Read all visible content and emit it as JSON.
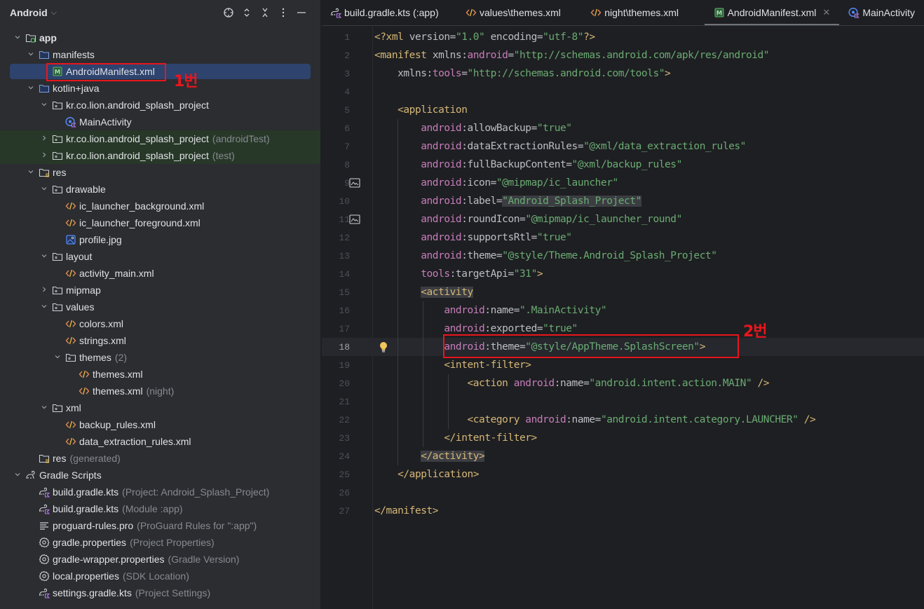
{
  "project_panel": {
    "title": "Android",
    "actions": [
      {
        "name": "locate-icon",
        "label": "Select Opened File"
      },
      {
        "name": "expand-all-icon",
        "label": "Expand All"
      },
      {
        "name": "collapse-all-icon",
        "label": "Collapse All"
      },
      {
        "name": "more-options-icon",
        "label": "Options"
      },
      {
        "name": "hide-panel-icon",
        "label": "Hide"
      }
    ],
    "tree": [
      {
        "label": "app",
        "hint": "",
        "level": 0,
        "arrow": "down",
        "icon": "module-folder",
        "bold": true
      },
      {
        "label": "manifests",
        "hint": "",
        "level": 1,
        "arrow": "down",
        "icon": "folder-blue"
      },
      {
        "label": "AndroidManifest.xml",
        "hint": "",
        "level": 2,
        "arrow": "",
        "icon": "manifest",
        "selected": true
      },
      {
        "label": "kotlin+java",
        "hint": "",
        "level": 1,
        "arrow": "down",
        "icon": "folder-blue"
      },
      {
        "label": "kr.co.lion.android_splash_project",
        "hint": "",
        "level": 2,
        "arrow": "down",
        "icon": "package"
      },
      {
        "label": "MainActivity",
        "hint": "",
        "level": 3,
        "arrow": "",
        "icon": "kotlin-class"
      },
      {
        "label": "kr.co.lion.android_splash_project",
        "hint": "(androidTest)",
        "level": 2,
        "arrow": "right",
        "icon": "package",
        "tested": true
      },
      {
        "label": "kr.co.lion.android_splash_project",
        "hint": "(test)",
        "level": 2,
        "arrow": "right",
        "icon": "package",
        "tested": true
      },
      {
        "label": "res",
        "hint": "",
        "level": 1,
        "arrow": "down",
        "icon": "res-folder"
      },
      {
        "label": "drawable",
        "hint": "",
        "level": 2,
        "arrow": "down",
        "icon": "package"
      },
      {
        "label": "ic_launcher_background.xml",
        "hint": "",
        "level": 3,
        "arrow": "",
        "icon": "xml"
      },
      {
        "label": "ic_launcher_foreground.xml",
        "hint": "",
        "level": 3,
        "arrow": "",
        "icon": "xml"
      },
      {
        "label": "profile.jpg",
        "hint": "",
        "level": 3,
        "arrow": "",
        "icon": "image"
      },
      {
        "label": "layout",
        "hint": "",
        "level": 2,
        "arrow": "down",
        "icon": "package"
      },
      {
        "label": "activity_main.xml",
        "hint": "",
        "level": 3,
        "arrow": "",
        "icon": "xml"
      },
      {
        "label": "mipmap",
        "hint": "",
        "level": 2,
        "arrow": "right",
        "icon": "package"
      },
      {
        "label": "values",
        "hint": "",
        "level": 2,
        "arrow": "down",
        "icon": "package"
      },
      {
        "label": "colors.xml",
        "hint": "",
        "level": 3,
        "arrow": "",
        "icon": "xml"
      },
      {
        "label": "strings.xml",
        "hint": "",
        "level": 3,
        "arrow": "",
        "icon": "xml"
      },
      {
        "label": "themes",
        "hint": "(2)",
        "level": 3,
        "arrow": "down",
        "icon": "package"
      },
      {
        "label": "themes.xml",
        "hint": "",
        "level": 4,
        "arrow": "",
        "icon": "xml"
      },
      {
        "label": "themes.xml",
        "hint": "(night)",
        "level": 4,
        "arrow": "",
        "icon": "xml"
      },
      {
        "label": "xml",
        "hint": "",
        "level": 2,
        "arrow": "down",
        "icon": "package"
      },
      {
        "label": "backup_rules.xml",
        "hint": "",
        "level": 3,
        "arrow": "",
        "icon": "xml"
      },
      {
        "label": "data_extraction_rules.xml",
        "hint": "",
        "level": 3,
        "arrow": "",
        "icon": "xml"
      },
      {
        "label": "res",
        "hint": "(generated)",
        "level": 1,
        "arrow": "",
        "icon": "res-folder"
      },
      {
        "label": "Gradle Scripts",
        "hint": "",
        "level": 0,
        "arrow": "down",
        "icon": "gradle"
      },
      {
        "label": "build.gradle.kts",
        "hint": "(Project: Android_Splash_Project)",
        "level": 1,
        "arrow": "",
        "icon": "gradle-kts"
      },
      {
        "label": "build.gradle.kts",
        "hint": "(Module :app)",
        "level": 1,
        "arrow": "",
        "icon": "gradle-kts"
      },
      {
        "label": "proguard-rules.pro",
        "hint": "(ProGuard Rules for \":app\")",
        "level": 1,
        "arrow": "",
        "icon": "text-lines"
      },
      {
        "label": "gradle.properties",
        "hint": "(Project Properties)",
        "level": 1,
        "arrow": "",
        "icon": "gear"
      },
      {
        "label": "gradle-wrapper.properties",
        "hint": "(Gradle Version)",
        "level": 1,
        "arrow": "",
        "icon": "gear"
      },
      {
        "label": "local.properties",
        "hint": "(SDK Location)",
        "level": 1,
        "arrow": "",
        "icon": "gear"
      },
      {
        "label": "settings.gradle.kts",
        "hint": "(Project Settings)",
        "level": 1,
        "arrow": "",
        "icon": "gradle-kts"
      }
    ]
  },
  "editor": {
    "tabs": [
      {
        "label": "build.gradle.kts (:app)",
        "icon": "gradle-kts",
        "active": false
      },
      {
        "label": "values\\themes.xml",
        "icon": "xml",
        "active": false
      },
      {
        "label": "night\\themes.xml",
        "icon": "xml",
        "active": false
      },
      {
        "label": "AndroidManifest.xml",
        "icon": "manifest",
        "active": true,
        "closable": true
      },
      {
        "label": "MainActivity",
        "icon": "kotlin-class",
        "active": false
      }
    ],
    "current_line": 18,
    "lines": [
      {
        "n": 1,
        "tokens": [
          [
            "tag",
            "<?xml "
          ],
          [
            "attr",
            "version"
          ],
          [
            "punct",
            "="
          ],
          [
            "val",
            "\"1.0\""
          ],
          [
            "attr",
            " encoding"
          ],
          [
            "punct",
            "="
          ],
          [
            "val",
            "\"utf-8\""
          ],
          [
            "tag",
            "?>"
          ]
        ]
      },
      {
        "n": 2,
        "tokens": [
          [
            "tag",
            "<manifest "
          ],
          [
            "attr",
            "xmlns:"
          ],
          [
            "ns",
            "android"
          ],
          [
            "punct",
            "="
          ],
          [
            "val",
            "\"http://schemas.android.com/apk/res/android\""
          ]
        ]
      },
      {
        "n": 3,
        "tokens": [
          [
            "punct",
            "    "
          ],
          [
            "attr",
            "xmlns:"
          ],
          [
            "ns",
            "tools"
          ],
          [
            "punct",
            "="
          ],
          [
            "val",
            "\"http://schemas.android.com/tools\""
          ],
          [
            "tag",
            ">"
          ]
        ]
      },
      {
        "n": 4,
        "tokens": []
      },
      {
        "n": 5,
        "tokens": [
          [
            "punct",
            "    "
          ],
          [
            "tag",
            "<application"
          ]
        ]
      },
      {
        "n": 6,
        "tokens": [
          [
            "punct",
            "        "
          ],
          [
            "ns",
            "android"
          ],
          [
            "attr",
            ":allowBackup"
          ],
          [
            "punct",
            "="
          ],
          [
            "val",
            "\"true\""
          ]
        ]
      },
      {
        "n": 7,
        "tokens": [
          [
            "punct",
            "        "
          ],
          [
            "ns",
            "android"
          ],
          [
            "attr",
            ":dataExtractionRules"
          ],
          [
            "punct",
            "="
          ],
          [
            "val",
            "\"@xml/data_extraction_rules\""
          ]
        ]
      },
      {
        "n": 8,
        "tokens": [
          [
            "punct",
            "        "
          ],
          [
            "ns",
            "android"
          ],
          [
            "attr",
            ":fullBackupContent"
          ],
          [
            "punct",
            "="
          ],
          [
            "val",
            "\"@xml/backup_rules\""
          ]
        ]
      },
      {
        "n": 9,
        "gutter": "image",
        "tokens": [
          [
            "punct",
            "        "
          ],
          [
            "ns",
            "android"
          ],
          [
            "attr",
            ":icon"
          ],
          [
            "punct",
            "="
          ],
          [
            "val",
            "\"@mipmap/ic_launcher\""
          ]
        ]
      },
      {
        "n": 10,
        "tokens": [
          [
            "punct",
            "        "
          ],
          [
            "ns",
            "android"
          ],
          [
            "attr",
            ":label"
          ],
          [
            "punct",
            "="
          ],
          [
            "val-hl",
            "\"Android_Splash_Project\""
          ]
        ]
      },
      {
        "n": 11,
        "gutter": "image",
        "tokens": [
          [
            "punct",
            "        "
          ],
          [
            "ns",
            "android"
          ],
          [
            "attr",
            ":roundIcon"
          ],
          [
            "punct",
            "="
          ],
          [
            "val",
            "\"@mipmap/ic_launcher_round\""
          ]
        ]
      },
      {
        "n": 12,
        "tokens": [
          [
            "punct",
            "        "
          ],
          [
            "ns",
            "android"
          ],
          [
            "attr",
            ":supportsRtl"
          ],
          [
            "punct",
            "="
          ],
          [
            "val",
            "\"true\""
          ]
        ]
      },
      {
        "n": 13,
        "tokens": [
          [
            "punct",
            "        "
          ],
          [
            "ns",
            "android"
          ],
          [
            "attr",
            ":theme"
          ],
          [
            "punct",
            "="
          ],
          [
            "val",
            "\"@style/Theme.Android_Splash_Project\""
          ]
        ]
      },
      {
        "n": 14,
        "tokens": [
          [
            "punct",
            "        "
          ],
          [
            "ns",
            "tools"
          ],
          [
            "attr",
            ":targetApi"
          ],
          [
            "punct",
            "="
          ],
          [
            "val",
            "\"31\""
          ],
          [
            "tag",
            ">"
          ]
        ]
      },
      {
        "n": 15,
        "tokens": [
          [
            "punct",
            "        "
          ],
          [
            "tag-hl",
            "<activity"
          ]
        ]
      },
      {
        "n": 16,
        "tokens": [
          [
            "punct",
            "            "
          ],
          [
            "ns",
            "android"
          ],
          [
            "attr",
            ":name"
          ],
          [
            "punct",
            "="
          ],
          [
            "val",
            "\".MainActivity\""
          ]
        ]
      },
      {
        "n": 17,
        "tokens": [
          [
            "punct",
            "            "
          ],
          [
            "ns",
            "android"
          ],
          [
            "attr",
            ":exported"
          ],
          [
            "punct",
            "="
          ],
          [
            "val",
            "\"true\""
          ]
        ]
      },
      {
        "n": 18,
        "gutter": "bulb",
        "tokens": [
          [
            "punct",
            "            "
          ],
          [
            "ns",
            "android"
          ],
          [
            "attr",
            ":theme"
          ],
          [
            "punct",
            "="
          ],
          [
            "val",
            "\"@style/AppTheme.SplashScreen\""
          ],
          [
            "tag",
            ">"
          ]
        ]
      },
      {
        "n": 19,
        "tokens": [
          [
            "punct",
            "            "
          ],
          [
            "tag",
            "<intent-filter>"
          ]
        ]
      },
      {
        "n": 20,
        "tokens": [
          [
            "punct",
            "                "
          ],
          [
            "tag",
            "<action "
          ],
          [
            "ns",
            "android"
          ],
          [
            "attr",
            ":name"
          ],
          [
            "punct",
            "="
          ],
          [
            "val",
            "\"android.intent.action.MAIN\""
          ],
          [
            "tag",
            " />"
          ]
        ]
      },
      {
        "n": 21,
        "tokens": []
      },
      {
        "n": 22,
        "tokens": [
          [
            "punct",
            "                "
          ],
          [
            "tag",
            "<category "
          ],
          [
            "ns",
            "android"
          ],
          [
            "attr",
            ":name"
          ],
          [
            "punct",
            "="
          ],
          [
            "val",
            "\"android.intent.category.LAUNCHER\""
          ],
          [
            "tag",
            " />"
          ]
        ]
      },
      {
        "n": 23,
        "tokens": [
          [
            "punct",
            "            "
          ],
          [
            "tag",
            "</intent-filter>"
          ]
        ]
      },
      {
        "n": 24,
        "tokens": [
          [
            "punct",
            "        "
          ],
          [
            "tag-hl",
            "</activity>"
          ]
        ]
      },
      {
        "n": 25,
        "tokens": [
          [
            "punct",
            "    "
          ],
          [
            "tag",
            "</application>"
          ]
        ]
      },
      {
        "n": 26,
        "tokens": []
      },
      {
        "n": 27,
        "tokens": [
          [
            "tag",
            "</manifest>"
          ]
        ]
      }
    ]
  },
  "annotations": [
    {
      "label": "1번",
      "target": "tree-item-AndroidManifest.xml"
    },
    {
      "label": "2번",
      "target": "code-line-18"
    }
  ],
  "colors": {
    "selection": "#2e436e",
    "annotation": "#e8161d",
    "xml_tag": "#d5b778",
    "xml_namespace": "#c77dbb",
    "xml_value": "#6aab73"
  }
}
